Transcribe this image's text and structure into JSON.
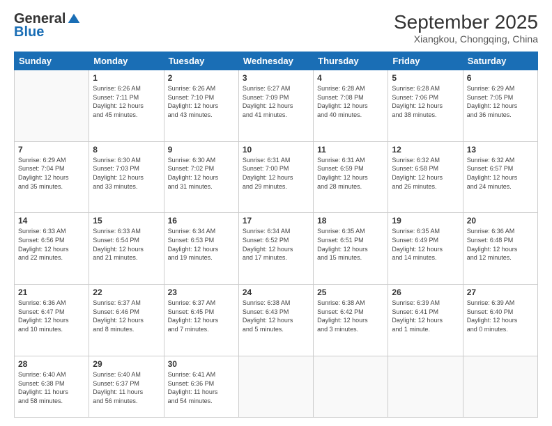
{
  "header": {
    "logo_general": "General",
    "logo_blue": "Blue",
    "month_title": "September 2025",
    "location": "Xiangkou, Chongqing, China"
  },
  "days_of_week": [
    "Sunday",
    "Monday",
    "Tuesday",
    "Wednesday",
    "Thursday",
    "Friday",
    "Saturday"
  ],
  "weeks": [
    [
      {
        "num": "",
        "info": ""
      },
      {
        "num": "1",
        "info": "Sunrise: 6:26 AM\nSunset: 7:11 PM\nDaylight: 12 hours\nand 45 minutes."
      },
      {
        "num": "2",
        "info": "Sunrise: 6:26 AM\nSunset: 7:10 PM\nDaylight: 12 hours\nand 43 minutes."
      },
      {
        "num": "3",
        "info": "Sunrise: 6:27 AM\nSunset: 7:09 PM\nDaylight: 12 hours\nand 41 minutes."
      },
      {
        "num": "4",
        "info": "Sunrise: 6:28 AM\nSunset: 7:08 PM\nDaylight: 12 hours\nand 40 minutes."
      },
      {
        "num": "5",
        "info": "Sunrise: 6:28 AM\nSunset: 7:06 PM\nDaylight: 12 hours\nand 38 minutes."
      },
      {
        "num": "6",
        "info": "Sunrise: 6:29 AM\nSunset: 7:05 PM\nDaylight: 12 hours\nand 36 minutes."
      }
    ],
    [
      {
        "num": "7",
        "info": "Sunrise: 6:29 AM\nSunset: 7:04 PM\nDaylight: 12 hours\nand 35 minutes."
      },
      {
        "num": "8",
        "info": "Sunrise: 6:30 AM\nSunset: 7:03 PM\nDaylight: 12 hours\nand 33 minutes."
      },
      {
        "num": "9",
        "info": "Sunrise: 6:30 AM\nSunset: 7:02 PM\nDaylight: 12 hours\nand 31 minutes."
      },
      {
        "num": "10",
        "info": "Sunrise: 6:31 AM\nSunset: 7:00 PM\nDaylight: 12 hours\nand 29 minutes."
      },
      {
        "num": "11",
        "info": "Sunrise: 6:31 AM\nSunset: 6:59 PM\nDaylight: 12 hours\nand 28 minutes."
      },
      {
        "num": "12",
        "info": "Sunrise: 6:32 AM\nSunset: 6:58 PM\nDaylight: 12 hours\nand 26 minutes."
      },
      {
        "num": "13",
        "info": "Sunrise: 6:32 AM\nSunset: 6:57 PM\nDaylight: 12 hours\nand 24 minutes."
      }
    ],
    [
      {
        "num": "14",
        "info": "Sunrise: 6:33 AM\nSunset: 6:56 PM\nDaylight: 12 hours\nand 22 minutes."
      },
      {
        "num": "15",
        "info": "Sunrise: 6:33 AM\nSunset: 6:54 PM\nDaylight: 12 hours\nand 21 minutes."
      },
      {
        "num": "16",
        "info": "Sunrise: 6:34 AM\nSunset: 6:53 PM\nDaylight: 12 hours\nand 19 minutes."
      },
      {
        "num": "17",
        "info": "Sunrise: 6:34 AM\nSunset: 6:52 PM\nDaylight: 12 hours\nand 17 minutes."
      },
      {
        "num": "18",
        "info": "Sunrise: 6:35 AM\nSunset: 6:51 PM\nDaylight: 12 hours\nand 15 minutes."
      },
      {
        "num": "19",
        "info": "Sunrise: 6:35 AM\nSunset: 6:49 PM\nDaylight: 12 hours\nand 14 minutes."
      },
      {
        "num": "20",
        "info": "Sunrise: 6:36 AM\nSunset: 6:48 PM\nDaylight: 12 hours\nand 12 minutes."
      }
    ],
    [
      {
        "num": "21",
        "info": "Sunrise: 6:36 AM\nSunset: 6:47 PM\nDaylight: 12 hours\nand 10 minutes."
      },
      {
        "num": "22",
        "info": "Sunrise: 6:37 AM\nSunset: 6:46 PM\nDaylight: 12 hours\nand 8 minutes."
      },
      {
        "num": "23",
        "info": "Sunrise: 6:37 AM\nSunset: 6:45 PM\nDaylight: 12 hours\nand 7 minutes."
      },
      {
        "num": "24",
        "info": "Sunrise: 6:38 AM\nSunset: 6:43 PM\nDaylight: 12 hours\nand 5 minutes."
      },
      {
        "num": "25",
        "info": "Sunrise: 6:38 AM\nSunset: 6:42 PM\nDaylight: 12 hours\nand 3 minutes."
      },
      {
        "num": "26",
        "info": "Sunrise: 6:39 AM\nSunset: 6:41 PM\nDaylight: 12 hours\nand 1 minute."
      },
      {
        "num": "27",
        "info": "Sunrise: 6:39 AM\nSunset: 6:40 PM\nDaylight: 12 hours\nand 0 minutes."
      }
    ],
    [
      {
        "num": "28",
        "info": "Sunrise: 6:40 AM\nSunset: 6:38 PM\nDaylight: 11 hours\nand 58 minutes."
      },
      {
        "num": "29",
        "info": "Sunrise: 6:40 AM\nSunset: 6:37 PM\nDaylight: 11 hours\nand 56 minutes."
      },
      {
        "num": "30",
        "info": "Sunrise: 6:41 AM\nSunset: 6:36 PM\nDaylight: 11 hours\nand 54 minutes."
      },
      {
        "num": "",
        "info": ""
      },
      {
        "num": "",
        "info": ""
      },
      {
        "num": "",
        "info": ""
      },
      {
        "num": "",
        "info": ""
      }
    ]
  ]
}
